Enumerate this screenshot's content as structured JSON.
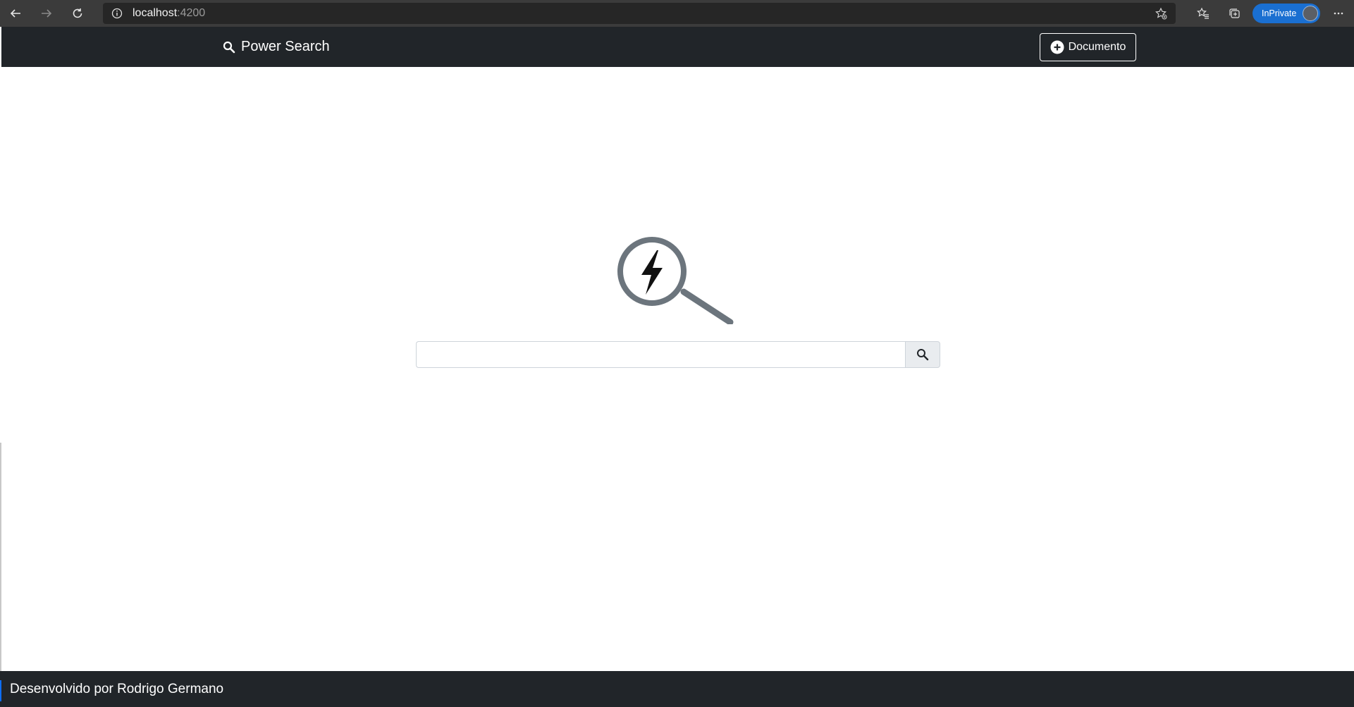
{
  "browser": {
    "url_host": "localhost",
    "url_port": ":4200",
    "inprivate_label": "InPrivate"
  },
  "navbar": {
    "brand": "Power Search",
    "new_document_label": "Documento"
  },
  "search": {
    "placeholder": "",
    "value": ""
  },
  "footer": {
    "text": "Desenvolvido por Rodrigo Germano"
  },
  "icons": {
    "back": "back-arrow-icon",
    "forward": "forward-arrow-icon",
    "refresh": "refresh-icon",
    "info": "info-icon",
    "favorite_add": "star-add-icon",
    "favorites": "favorites-icon",
    "collections": "collections-icon",
    "more": "more-icon",
    "brand": "search-icon",
    "add": "plus-circle-icon",
    "logo": "lightning-magnifier-icon",
    "search_button": "search-icon"
  },
  "colors": {
    "navbar_bg": "#212529",
    "browser_bg": "#3b3b3b",
    "inprivate_bg": "#1a6fd1",
    "logo_gray": "#6c757d"
  }
}
